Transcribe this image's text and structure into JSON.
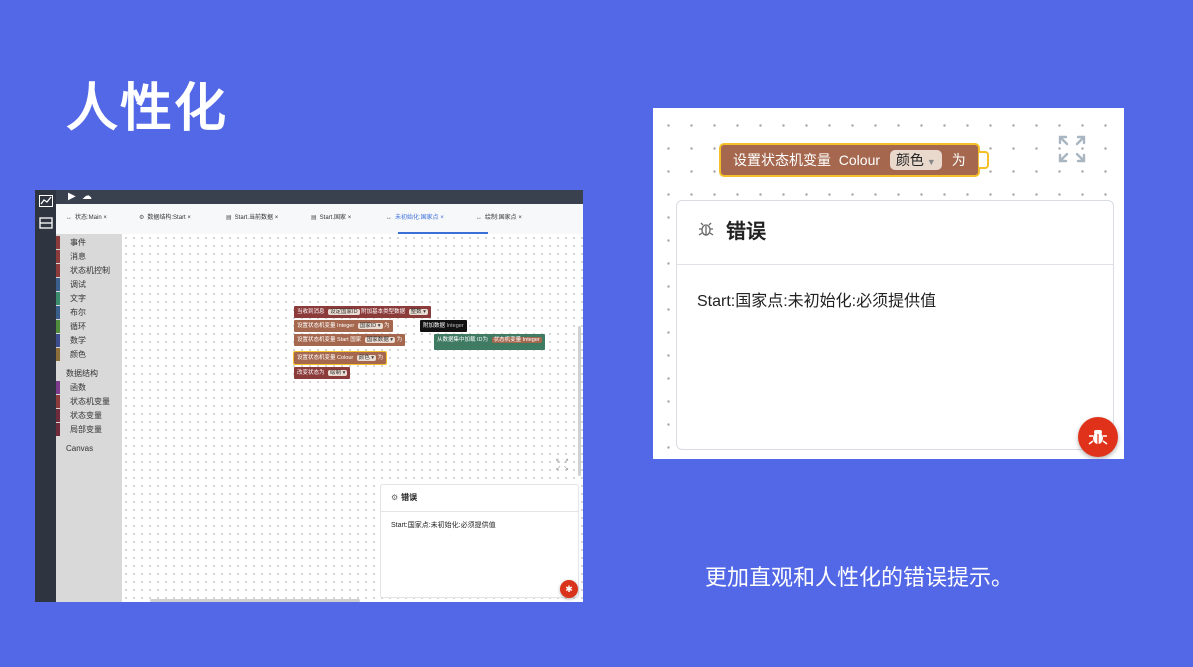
{
  "slide": {
    "title": "人性化",
    "caption": "更加直观和人性化的错误提示。"
  },
  "left_app": {
    "rail_icons": [
      "chart-icon",
      "inbox-icon"
    ],
    "toolbar": {
      "play": "▶",
      "cloud": "☁"
    },
    "tabs": [
      {
        "icon": "↔",
        "label": "状态:Main",
        "close": "×"
      },
      {
        "icon": "⚙",
        "label": "数据结构:Start",
        "close": "×"
      },
      {
        "icon": "▤",
        "label": "Start.当前数据",
        "close": "×"
      },
      {
        "icon": "▤",
        "label": "Start.国家",
        "close": "×"
      },
      {
        "icon": "↔",
        "label": "未初始化:国家点",
        "close": "×"
      },
      {
        "icon": "↔",
        "label": "绘制:国家点",
        "close": "×"
      }
    ],
    "palette": [
      {
        "label": "事件",
        "color": "#8c3b3b"
      },
      {
        "label": "消息",
        "color": "#8c3b3b"
      },
      {
        "label": "状态机控制",
        "color": "#8c3b3b"
      },
      {
        "label": "调试",
        "color": "#3b5f8c"
      },
      {
        "label": "文字",
        "color": "#3b8c6e"
      },
      {
        "label": "布尔",
        "color": "#3b5f8c"
      },
      {
        "label": "循环",
        "color": "#4f8c3b"
      },
      {
        "label": "数学",
        "color": "#3b4d8c"
      },
      {
        "label": "颜色",
        "color": "#8c6e3b"
      }
    ],
    "palette_group_label": "数据结构",
    "palette2": [
      {
        "label": "函数",
        "color": "#7d3b8c"
      },
      {
        "label": "状态机变量",
        "color": "#8c3b3b"
      },
      {
        "label": "状态变量",
        "color": "#6e2b3b"
      },
      {
        "label": "局部变量",
        "color": "#6e2b3b"
      }
    ],
    "palette_canvas_label": "Canvas",
    "blocks": {
      "b1": {
        "text": "当收到消息",
        "f1": "设定国家ID",
        "t2": "附加基本类型数据",
        "f2": "整数 ▾"
      },
      "b2": {
        "text": "设置状态机变量",
        "t1": "Integer",
        "f1": "国家ID ▾",
        "t2": "为",
        "tooltip1": "附加数据",
        "tooltip2": "Integer"
      },
      "b3": {
        "text": "设置状态机变量",
        "t1": "Start 国家",
        "f1": "国家数据 ▾",
        "t2": "为",
        "t3": "从数据集中加载 ID为",
        "t4": "状态机变量",
        "t5": "Integer"
      },
      "b4": {
        "text": "设置状态机变量",
        "t1": "Colour",
        "f1": "颜色 ▾",
        "t2": "为"
      },
      "b5": {
        "text": "改变状态为",
        "f1": "绘制 ▾"
      }
    },
    "error_panel": {
      "title": "错误",
      "message": "Start:国家点:未初始化:必须提供值"
    }
  },
  "right_zoom": {
    "block": {
      "text": "设置状态机变量",
      "type": "Colour",
      "dropdown": "颜色",
      "suffix": "为"
    },
    "error_panel": {
      "title": "错误",
      "message": "Start:国家点:未初始化:必须提供值"
    },
    "bug_icon": "bug-icon"
  }
}
